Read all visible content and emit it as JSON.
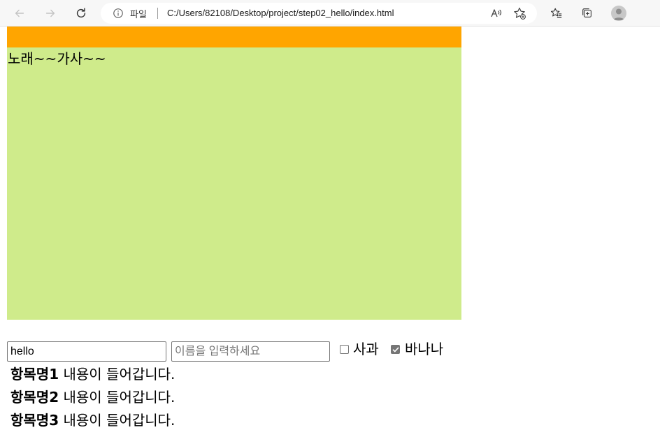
{
  "browser": {
    "scheme_label": "파일",
    "url": "C:/Users/82108/Desktop/project/step02_hello/index.html",
    "icons": [
      "back-arrow-icon",
      "forward-arrow-icon",
      "refresh-icon",
      "info-icon",
      "read-aloud-icon",
      "add-favorite-icon",
      "favorites-icon",
      "collections-icon",
      "profile-avatar-icon"
    ]
  },
  "colors": {
    "header_bar": "#ffa500",
    "lyrics_box": "#cfeb8b"
  },
  "lyrics": {
    "text": "노래~~가사~~"
  },
  "form": {
    "name_value": "hello",
    "placeholder": "이름을 입력하세요",
    "checkboxes": [
      {
        "label": "사과",
        "checked": false
      },
      {
        "label": "바나나",
        "checked": true
      }
    ]
  },
  "items": [
    {
      "term": "항목명1",
      "desc": "내용이 들어갑니다."
    },
    {
      "term": "항목명2",
      "desc": "내용이 들어갑니다."
    },
    {
      "term": "항목명3",
      "desc": "내용이 들어갑니다."
    }
  ]
}
